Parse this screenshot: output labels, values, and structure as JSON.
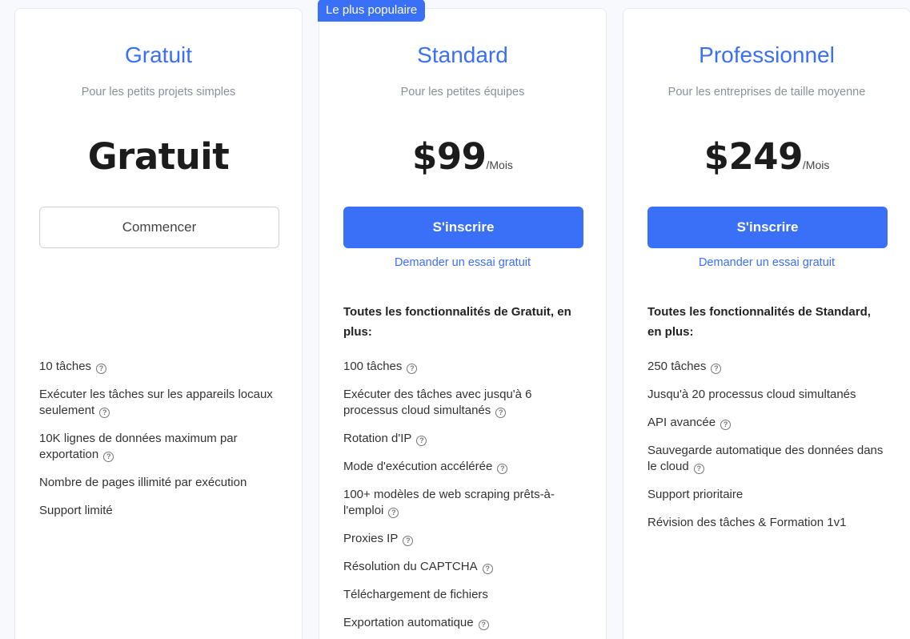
{
  "plans": [
    {
      "name": "Gratuit",
      "description": "Pour les petits projets simples",
      "price": "Gratuit",
      "period": "",
      "button_label": "Commencer",
      "features": [
        {
          "text": "10 tâches",
          "help": true
        },
        {
          "text": "Exécuter les tâches sur les appareils locaux seulement",
          "help": true
        },
        {
          "text": "10K lignes de données maximum par exportation",
          "help": true
        },
        {
          "text": "Nombre de pages illimité par exécution",
          "help": false
        },
        {
          "text": "Support limité",
          "help": false
        }
      ]
    },
    {
      "badge": "Le plus populaire",
      "name": "Standard",
      "description": "Pour les petites équipes",
      "price": "$99",
      "period": "/Mois",
      "button_label": "S'inscrire",
      "trial_link": "Demander un essai gratuit",
      "includes": "Toutes les fonctionnalités de Gratuit, en plus:",
      "features": [
        {
          "text": "100 tâches",
          "help": true
        },
        {
          "text": "Exécuter des tâches avec jusqu'à 6 processus cloud simultanés",
          "help": true
        },
        {
          "text": "Rotation d'IP",
          "help": true
        },
        {
          "text": "Mode d'exécution accélérée",
          "help": true
        },
        {
          "text": "100+ modèles de web scraping prêts-à-l'emploi",
          "help": true
        },
        {
          "text": "Proxies IP",
          "help": true
        },
        {
          "text": "Résolution du CAPTCHA",
          "help": true
        },
        {
          "text": "Téléchargement de fichiers",
          "help": false
        },
        {
          "text": "Exportation automatique",
          "help": true
        }
      ]
    },
    {
      "name": "Professionnel",
      "description": "Pour les entreprises de taille moyenne",
      "price": "$249",
      "period": "/Mois",
      "button_label": "S'inscrire",
      "trial_link": "Demander un essai gratuit",
      "includes": "Toutes les fonctionnalités de Standard, en plus:",
      "features": [
        {
          "text": "250 tâches",
          "help": true
        },
        {
          "text": "Jusqu'à 20 processus cloud simultanés",
          "help": false
        },
        {
          "text": "API avancée",
          "help": true
        },
        {
          "text": "Sauvegarde automatique des données dans le cloud",
          "help": true
        },
        {
          "text": "Support prioritaire",
          "help": false
        },
        {
          "text": "Révision des tâches & Formation 1v1",
          "help": false
        }
      ]
    }
  ],
  "help_icon": "question-circle-icon",
  "colors": {
    "accent": "#3a6ff7",
    "background": "#f7f9fc"
  }
}
